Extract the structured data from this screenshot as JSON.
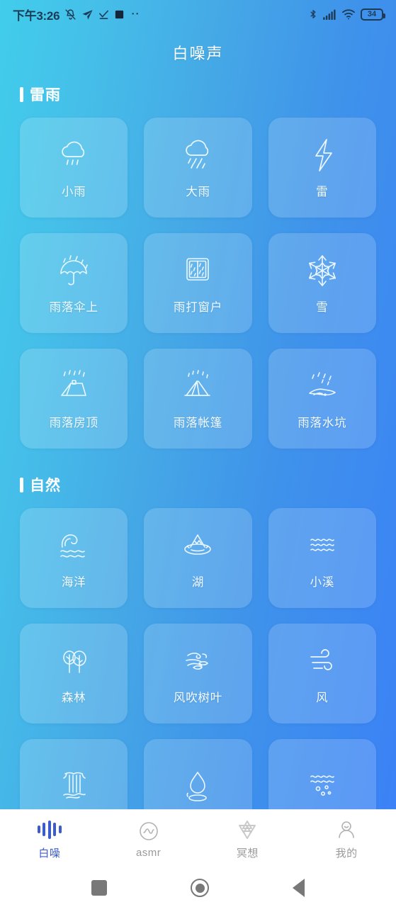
{
  "status_bar": {
    "time": "下午3:26",
    "battery_percent": "34",
    "left_icons": [
      "mute-bell-icon",
      "send-arrow-icon",
      "check-icon",
      "square-icon",
      "ellipsis-icon"
    ],
    "right_icons": [
      "bluetooth-icon",
      "cellular-signal-icon",
      "wifi-icon",
      "battery-icon"
    ]
  },
  "header": {
    "title": "白噪声"
  },
  "sections": [
    {
      "title": "雷雨",
      "items": [
        {
          "label": "小雨",
          "icon": "light-rain-cloud-icon"
        },
        {
          "label": "大雨",
          "icon": "heavy-rain-cloud-icon"
        },
        {
          "label": "雷",
          "icon": "lightning-bolt-icon"
        },
        {
          "label": "雨落伞上",
          "icon": "umbrella-rain-icon"
        },
        {
          "label": "雨打窗户",
          "icon": "rain-window-icon"
        },
        {
          "label": "雪",
          "icon": "snowflake-icon"
        },
        {
          "label": "雨落房顶",
          "icon": "rain-roof-icon"
        },
        {
          "label": "雨落帐篷",
          "icon": "rain-tent-icon"
        },
        {
          "label": "雨落水坑",
          "icon": "rain-puddle-icon"
        }
      ]
    },
    {
      "title": "自然",
      "items": [
        {
          "label": "海洋",
          "icon": "ocean-wave-icon"
        },
        {
          "label": "湖",
          "icon": "lake-mountain-icon"
        },
        {
          "label": "小溪",
          "icon": "stream-waves-icon"
        },
        {
          "label": "森林",
          "icon": "forest-trees-icon"
        },
        {
          "label": "风吹树叶",
          "icon": "wind-leaves-icon"
        },
        {
          "label": "风",
          "icon": "wind-icon"
        },
        {
          "label": "",
          "icon": "waterfall-icon"
        },
        {
          "label": "",
          "icon": "water-drop-icon"
        },
        {
          "label": "",
          "icon": "bubbles-icon"
        }
      ]
    }
  ],
  "tabbar": {
    "items": [
      {
        "label": "白噪",
        "icon": "waveform-icon",
        "active": true
      },
      {
        "label": "asmr",
        "icon": "sound-wave-circle-icon",
        "active": false
      },
      {
        "label": "冥想",
        "icon": "six-point-star-icon",
        "active": false
      },
      {
        "label": "我的",
        "icon": "person-icon",
        "active": false
      }
    ],
    "active_color": "#3c5ccd",
    "inactive_color": "#9a9a9a"
  },
  "nav_bar": {
    "buttons": [
      "recents-square-button",
      "home-circle-button",
      "back-triangle-button"
    ]
  },
  "theme": {
    "gradient_start": "#41cdeb",
    "gradient_end": "#3b82f6",
    "card_overlay": "rgba(255,255,255,0.17)"
  }
}
